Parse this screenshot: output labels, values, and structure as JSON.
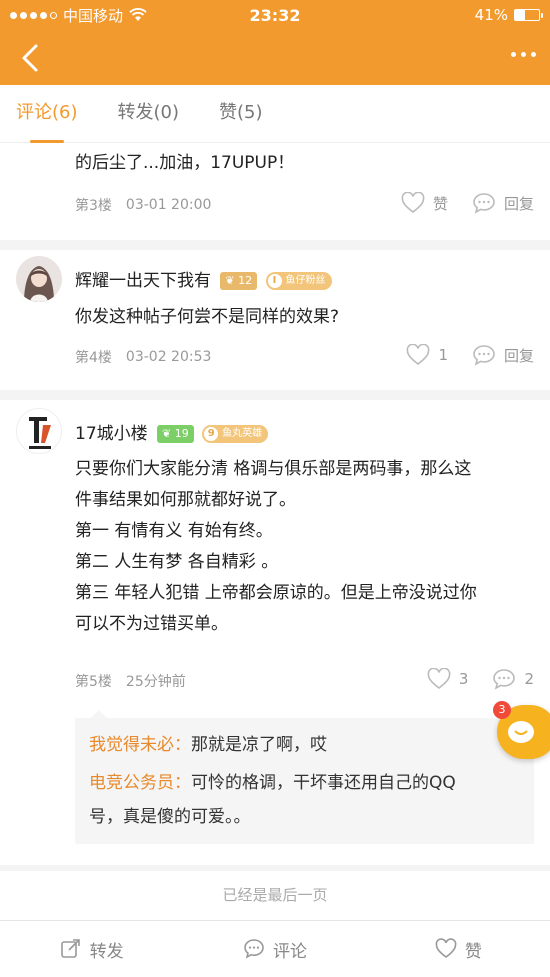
{
  "status_bar": {
    "carrier": "中国移动",
    "time": "23:32",
    "battery": "41%",
    "battery_level": 0.41
  },
  "tabs": [
    {
      "label": "评论(6)",
      "active": true
    },
    {
      "label": "转发(0)",
      "active": false
    },
    {
      "label": "赞(5)",
      "active": false
    }
  ],
  "comments": [
    {
      "partial_text": "的后尘了...加油，17UPUP！",
      "floor": "第3楼",
      "time": "03-01 20:00",
      "like_label": "赞",
      "reply_label": "回复"
    },
    {
      "username": "辉耀一出天下我有",
      "level": "12",
      "title": "鱼仔粉丝",
      "text": "你发这种帖子何尝不是同样的效果?",
      "floor": "第4楼",
      "time": "03-02 20:53",
      "like_count": "1",
      "reply_label": "回复"
    },
    {
      "username": "17城小楼",
      "level": "19",
      "title": "鱼丸英雄",
      "text_lines": [
        "只要你们大家能分清 格调与俱乐部是两码事，那么这",
        "件事结果如何那就都好说了。",
        "第一 有情有义 有始有终。",
        "第二 人生有梦 各自精彩 。",
        "第三 年轻人犯错 上帝都会原谅的。但是上帝没说过你",
        "可以不为过错买单。"
      ],
      "floor": "第5楼",
      "time": "25分钟前",
      "like_count": "3",
      "reply_count": "2",
      "replies": [
        {
          "author": "我觉得未必：",
          "text": "那就是凉了啊，哎"
        },
        {
          "author": "电竞公务员：",
          "text": "可怜的格调，干坏事还用自己的QQ",
          "text2": "号，真是傻的可爱。。"
        }
      ]
    }
  ],
  "last_page_text": "已经是最后一页",
  "float_badge": "3",
  "bottom_bar": {
    "forward": "转发",
    "comment": "评论",
    "like": "赞"
  },
  "colors": {
    "accent": "#f39a2e",
    "reply_author": "#e8892c",
    "level_badge_12": "#e9b96b",
    "level_badge_19": "#7ccf66",
    "title_badge": "#f2c57a"
  },
  "icons": [
    "back-icon",
    "more-icon",
    "heart-icon",
    "bubble-icon",
    "share-icon",
    "comment-icon",
    "wifi-icon",
    "battery-icon"
  ]
}
